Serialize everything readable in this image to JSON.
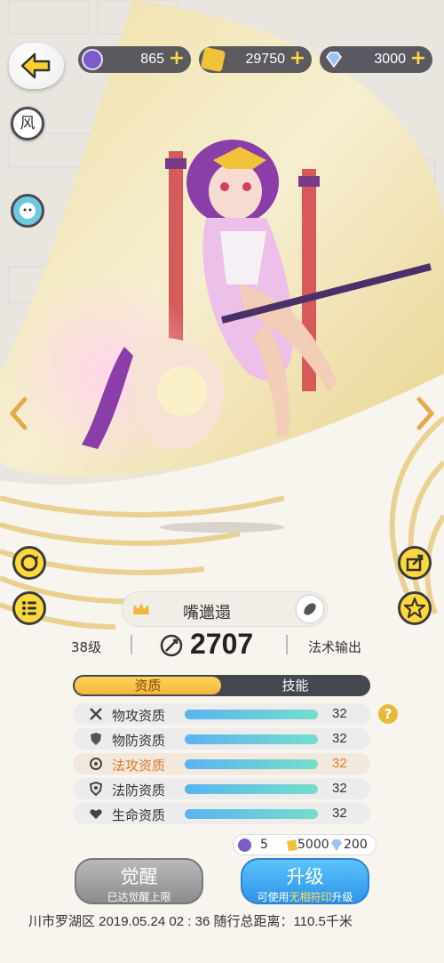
{
  "topbar": {
    "currencies": [
      {
        "icon": "soul-orb-icon",
        "value": "865",
        "color": "#7b5cc8"
      },
      {
        "icon": "gold-ingot-icon",
        "value": "29750",
        "color": "#f1c23a"
      },
      {
        "icon": "diamond-icon",
        "value": "3000",
        "color": "#8fb6f0"
      }
    ],
    "plus": "+"
  },
  "left_tools": {
    "element_badge": "风"
  },
  "character": {
    "name": "嘴邋遢",
    "level": "38级",
    "power": "2707",
    "role": "法术输出"
  },
  "tabs": [
    {
      "label": "资质",
      "active": true
    },
    {
      "label": "技能",
      "active": false
    }
  ],
  "attributes": [
    {
      "icon": "swords-icon",
      "label": "物攻资质",
      "value": "32",
      "fill": 1.0,
      "highlight": false
    },
    {
      "icon": "shield-icon",
      "label": "物防资质",
      "value": "32",
      "fill": 1.0,
      "highlight": false
    },
    {
      "icon": "magic-swirl-icon",
      "label": "法攻资质",
      "value": "32",
      "fill": 1.0,
      "highlight": true
    },
    {
      "icon": "magic-shield-icon",
      "label": "法防资质",
      "value": "32",
      "fill": 1.0,
      "highlight": false
    },
    {
      "icon": "heart-icon",
      "label": "生命资质",
      "value": "32",
      "fill": 1.0,
      "highlight": false
    }
  ],
  "help": "?",
  "cost": {
    "orb": "5",
    "gold": "5000",
    "diamond": "200"
  },
  "buttons": {
    "awaken": {
      "title": "觉醒",
      "subtitle": "已达觉醒上限"
    },
    "upgrade": {
      "title": "升级",
      "subtitle_prefix": "可使用",
      "subtitle_highlight": "无相符印",
      "subtitle_suffix": "升级"
    }
  },
  "footer": "川市罗湖区  2019.05.24   02 : 36  随行总距离：110.5千米",
  "colors": {
    "accent_gold": "#f3b63a",
    "upgrade_blue": "#3aa8f0",
    "awaken_gray": "#9a9a9a",
    "highlight_orange": "#e07a2a"
  }
}
